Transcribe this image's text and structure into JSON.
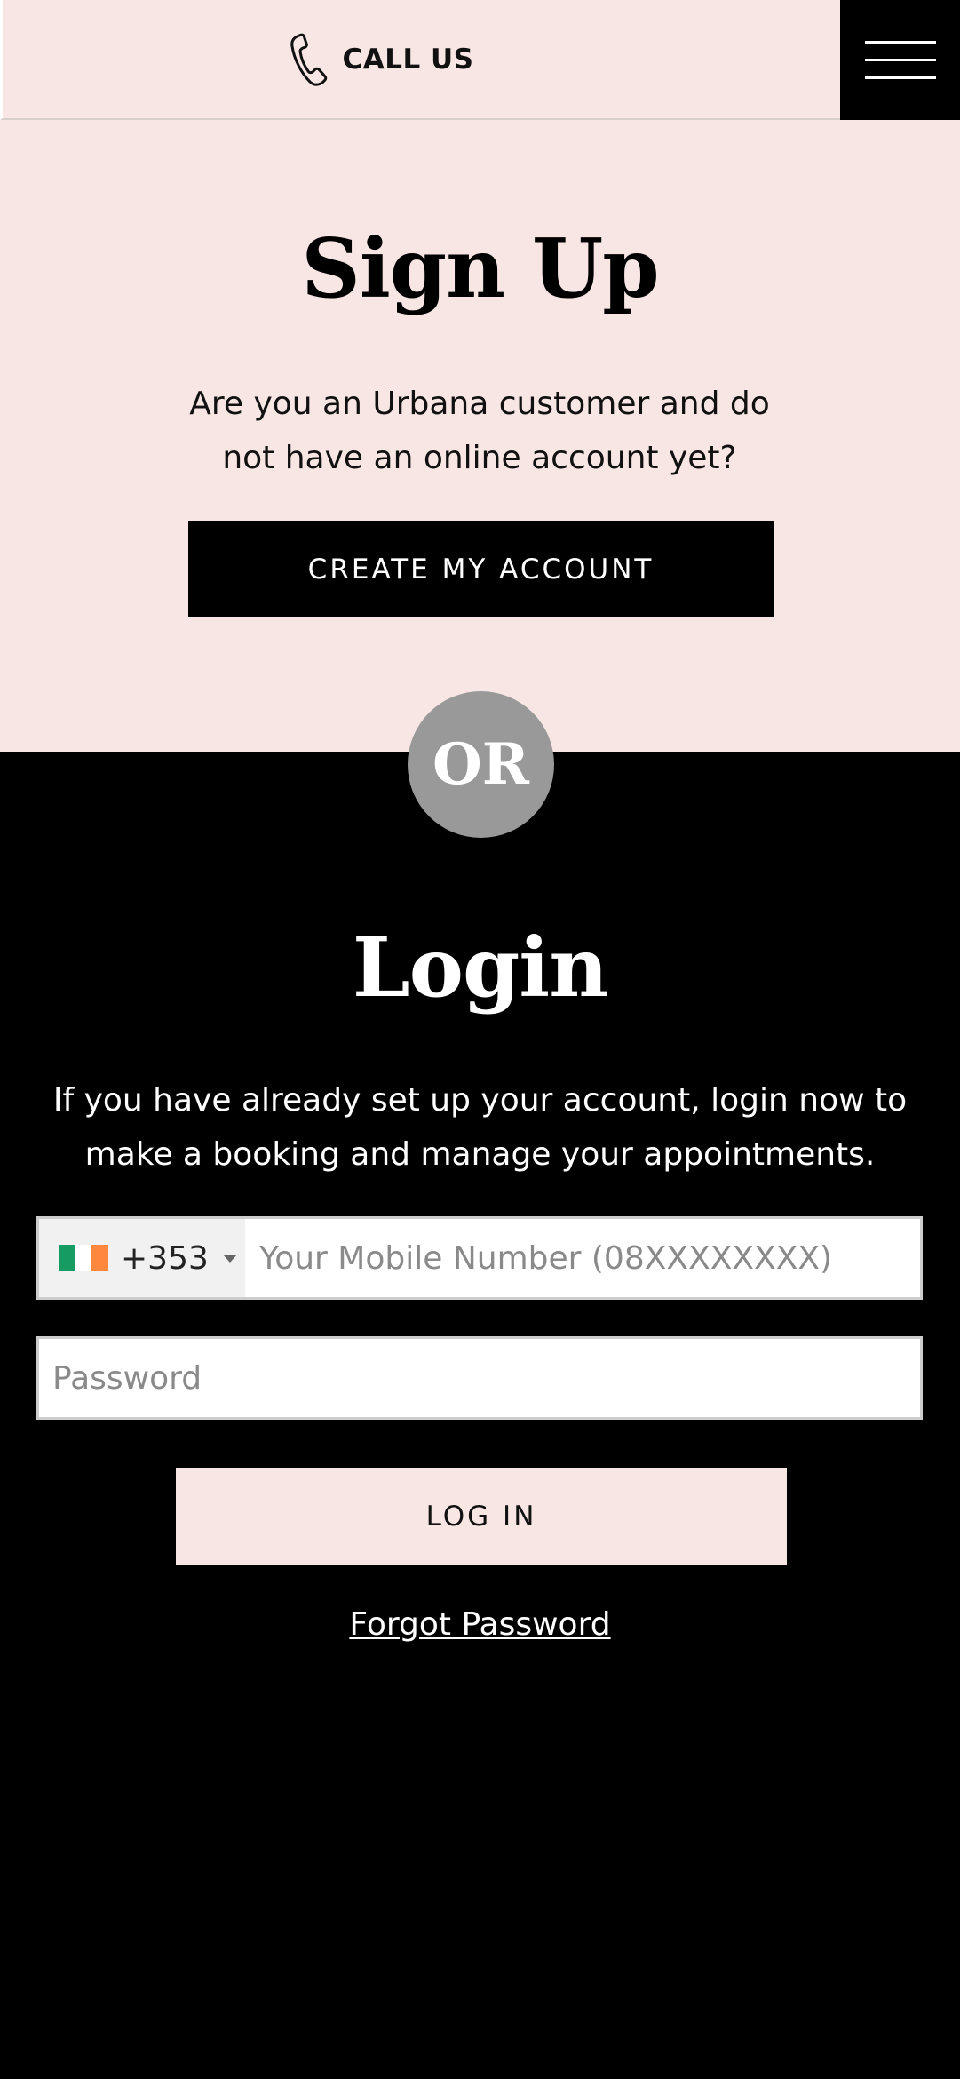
{
  "header": {
    "call_label": "CALL US",
    "phone_icon": "phone-icon",
    "menu_icon": "hamburger-menu-icon"
  },
  "signup": {
    "title": "Sign Up",
    "description": "Are you an Urbana customer and do not have an online account yet?",
    "create_button": "CREATE MY ACCOUNT"
  },
  "divider": {
    "label": "OR"
  },
  "login": {
    "title": "Login",
    "description": "If you have already set up your account, login now to make a booking and manage your appointments.",
    "country": {
      "dial_code": "+353",
      "flag_icon": "ireland-flag-icon",
      "flag_colors": [
        "#169b62",
        "#ffffff",
        "#ff883e"
      ]
    },
    "phone_placeholder": "Your Mobile Number (08XXXXXXXX)",
    "phone_value": "",
    "password_placeholder": "Password",
    "password_value": "",
    "login_button": "LOG IN",
    "forgot_link": "Forgot Password"
  },
  "colors": {
    "blush": "#f7e6e3",
    "black": "#000000",
    "or_circle": "#999999"
  }
}
